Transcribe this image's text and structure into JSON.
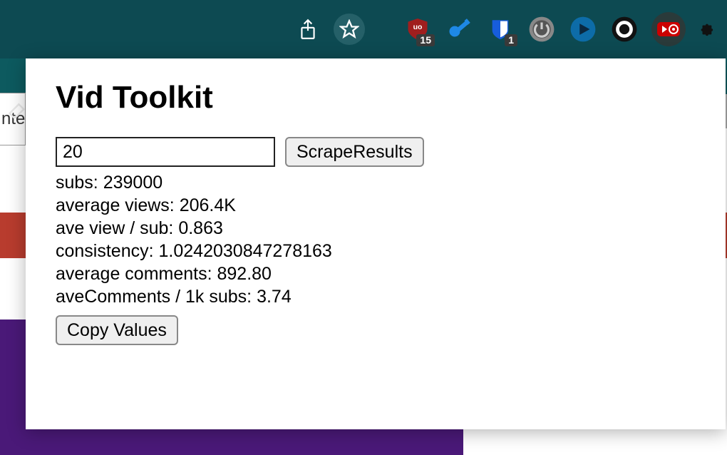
{
  "toolbar": {
    "ublock_badge": "15",
    "bitwarden_badge": "1"
  },
  "underpage": {
    "input_fragment": "nte"
  },
  "popup": {
    "title": "Vid Toolkit",
    "input_value": "20",
    "scrape_button": "ScrapeResults",
    "copy_button": "Copy Values",
    "stats": {
      "subs_label": "subs: ",
      "subs_value": "239000",
      "avg_views_label": "average views: ",
      "avg_views_value": "206.4K",
      "view_per_sub_label": "ave view / sub: ",
      "view_per_sub_value": "0.863",
      "consistency_label": "consistency: ",
      "consistency_value": "1.0242030847278163",
      "avg_comments_label": "average comments: ",
      "avg_comments_value": "892.80",
      "comments_per_1k_label": "aveComments / 1k subs: ",
      "comments_per_1k_value": "3.74"
    }
  }
}
